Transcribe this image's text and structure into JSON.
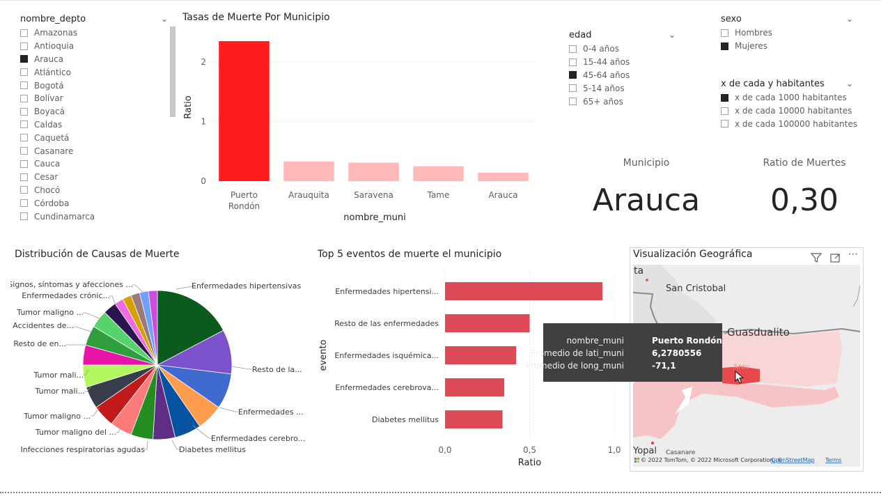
{
  "slicers": {
    "depto": {
      "title": "nombre_depto",
      "items": [
        {
          "label": "Amazonas",
          "checked": false
        },
        {
          "label": "Antioquia",
          "checked": false
        },
        {
          "label": "Arauca",
          "checked": true
        },
        {
          "label": "Atlántico",
          "checked": false
        },
        {
          "label": "Bogotá",
          "checked": false
        },
        {
          "label": "Bolívar",
          "checked": false
        },
        {
          "label": "Boyacá",
          "checked": false
        },
        {
          "label": "Caldas",
          "checked": false
        },
        {
          "label": "Caquetá",
          "checked": false
        },
        {
          "label": "Casanare",
          "checked": false
        },
        {
          "label": "Cauca",
          "checked": false
        },
        {
          "label": "Cesar",
          "checked": false
        },
        {
          "label": "Chocó",
          "checked": false
        },
        {
          "label": "Córdoba",
          "checked": false
        },
        {
          "label": "Cundinamarca",
          "checked": false
        }
      ]
    },
    "edad": {
      "title": "edad",
      "items": [
        {
          "label": "0-4 años",
          "checked": false
        },
        {
          "label": "15-44 años",
          "checked": false
        },
        {
          "label": "45-64 años",
          "checked": true
        },
        {
          "label": "5-14 años",
          "checked": false
        },
        {
          "label": "65+ años",
          "checked": false
        }
      ]
    },
    "sexo": {
      "title": "sexo",
      "items": [
        {
          "label": "Hombres",
          "checked": false
        },
        {
          "label": "Mujeres",
          "checked": true
        }
      ]
    },
    "habitantes": {
      "title": "x de cada y habitantes",
      "items": [
        {
          "label": "x de cada 1000 habitantes",
          "checked": true
        },
        {
          "label": "x de cada 10000 habitantes",
          "checked": false
        },
        {
          "label": "x de cada 100000 habitantes",
          "checked": false
        }
      ]
    }
  },
  "cards": {
    "municipio_label": "Municipio",
    "municipio_value": "Arauca",
    "ratio_label": "Ratio de Muertes",
    "ratio_value": "0,30"
  },
  "map": {
    "title": "Visualización Geográfica",
    "labels": {
      "san_cristobal": "San Cristobal",
      "guasdualito": "Guasdualito",
      "yopal": "Yopal",
      "casanare": "Casanare",
      "partial_left": "ta",
      "arauca_partial": "Arau"
    },
    "attribution": "© 2022 TomTom, © 2022 Microsoft Corporation, ©",
    "osm_link": "OpenStreetMap",
    "terms": "Terms",
    "tooltip": [
      {
        "key": "nombre_muni",
        "value": "Puerto Rondón"
      },
      {
        "key": "Promedio de lati_muni",
        "value": "6,2780556"
      },
      {
        "key": "Promedio de long_muni",
        "value": "-71,1"
      }
    ]
  },
  "chart_data": [
    {
      "type": "bar",
      "title": "Tasas de Muerte Por Municipio",
      "xlabel": "nombre_muni",
      "ylabel": "Ratio",
      "categories": [
        [
          "Puerto",
          "Rondón"
        ],
        [
          "Arauquita"
        ],
        [
          "Saravena"
        ],
        [
          "Tame"
        ],
        [
          "Arauca"
        ]
      ],
      "values": [
        2.35,
        0.33,
        0.31,
        0.25,
        0.14
      ],
      "highlight_index": 0,
      "yticks": [
        "0",
        "1",
        "2"
      ],
      "ylim": [
        0,
        2.5
      ],
      "colors": {
        "highlight": "#ff1c1c",
        "dim": "#ffb9b9"
      }
    },
    {
      "type": "pie",
      "title": "Distribución de Causas de Muerte",
      "labels": [
        "Enfermedades hipertensivas",
        "Resto de la...",
        "Enfermedades ...",
        "Enfermedades cerebro...",
        "Diabetes mellitus",
        "Infecciones respiratorias agudas",
        "Tumor maligno del ...",
        "Tumor maligno ...",
        "Tumor mali...",
        "Tumor mali...",
        "Resto de en...",
        "Accidentes de...",
        "Tumor maligno ...",
        "Enfermedades crónic...",
        "Signos, síntomas y afecciones ..."
      ],
      "values": [
        18,
        10,
        8,
        6,
        6,
        5,
        5,
        5,
        5,
        5,
        5,
        4.5,
        4.5,
        4,
        3,
        2,
        2,
        2,
        2,
        2
      ],
      "colors": [
        "#0b5a1e",
        "#7c52cc",
        "#3f6bcf",
        "#ff9c4e",
        "#0452a0",
        "#5e2e87",
        "#238d21",
        "#ff7b7b",
        "#c01a1a",
        "#373d4a",
        "#b3f75e",
        "#e714a8",
        "#2f9e3d",
        "#56d36a",
        "#2a1450",
        "#f06ae0",
        "#d6a100",
        "#9b7a7a",
        "#6ea0ff",
        "#d04be0"
      ]
    },
    {
      "type": "bar",
      "orientation": "horizontal",
      "title": "Top 5 eventos de muerte el municipio",
      "xlabel": "Ratio",
      "ylabel": "evento",
      "categories": [
        "Enfermedades hipertensi...",
        "Resto de las enfermedades",
        "Enfermedades isquémica...",
        "Enfermedades cerebrova...",
        "Diabetes mellitus"
      ],
      "values": [
        0.93,
        0.5,
        0.42,
        0.35,
        0.34
      ],
      "xticks": [
        "0,0",
        "0,5",
        "1,0"
      ],
      "xlim": [
        0,
        1
      ],
      "color": "#dc4b55"
    }
  ]
}
